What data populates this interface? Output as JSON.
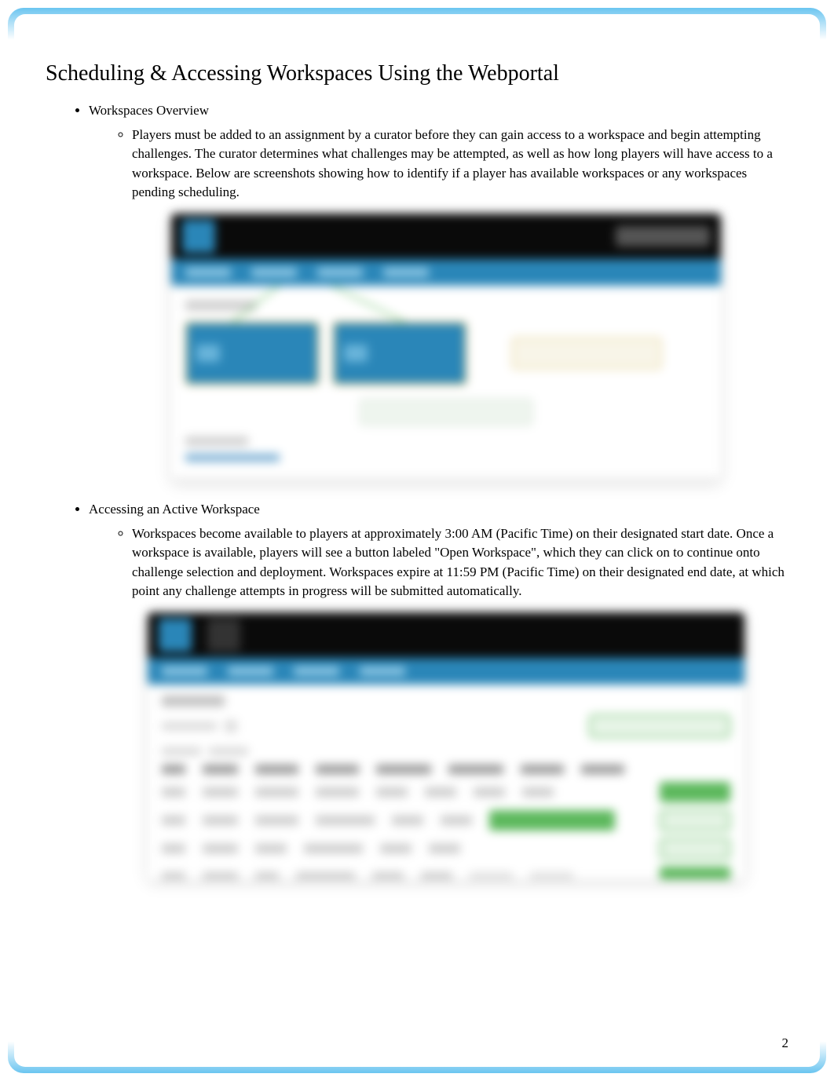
{
  "page": {
    "title": "Scheduling & Accessing Workspaces Using the Webportal",
    "number": "2"
  },
  "sections": [
    {
      "heading": "Workspaces Overview",
      "body": "Players must be added to an assignment by a curator before they can gain access to a workspace and begin attempting challenges. The curator determines what challenges may be attempted, as well as how long players will have access to a workspace. Below are screenshots showing how to identify if a player has available workspaces or any workspaces pending scheduling."
    },
    {
      "heading": "Accessing an Active Workspace",
      "body": "Workspaces become available to players at approximately 3:00 AM (Pacific Time) on their designated start date. Once a workspace is available, players will see a button labeled \"Open Workspace\", which they can click on to continue onto challenge selection and deployment. Workspaces expire at 11:59 PM (Pacific Time) on their designated end date, at which point any challenge attempts in progress will be submitted automatically."
    }
  ],
  "colors": {
    "border_gradient": "#6bc5f0",
    "nav_blue": "#2a86b8",
    "accent_green": "#5cb85c",
    "accent_yellow": "#d4b24a"
  }
}
